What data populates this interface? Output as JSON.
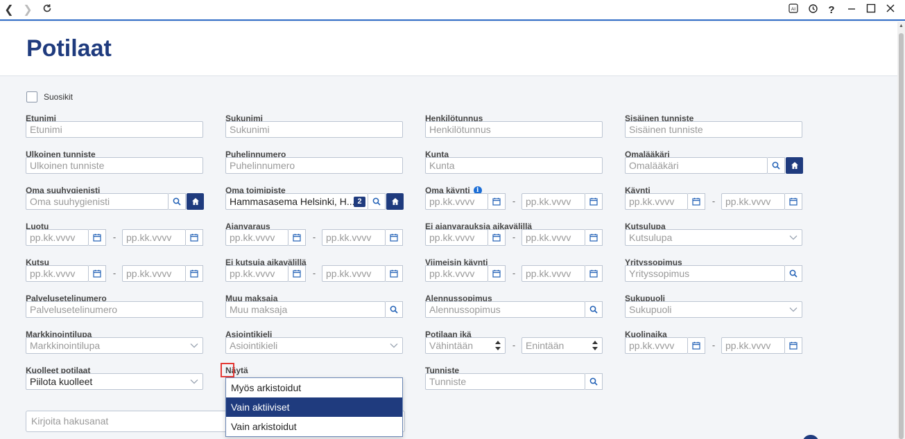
{
  "topbar": {
    "back_icon": "back-arrow-icon",
    "forward_icon": "forward-arrow-icon",
    "reload_icon": "reload-icon",
    "ai_label": "AI",
    "help_label": "?"
  },
  "page": {
    "title": "Potilaat"
  },
  "favorites": {
    "label": "Suosikit",
    "checked": false
  },
  "fields": {
    "etunimi": {
      "label": "Etunimi",
      "placeholder": "Etunimi"
    },
    "sukunimi": {
      "label": "Sukunimi",
      "placeholder": "Sukunimi"
    },
    "henkilotunnus": {
      "label": "Henkilötunnus",
      "placeholder": "Henkilötunnus"
    },
    "sisainen": {
      "label": "Sisäinen tunniste",
      "placeholder": "Sisäinen tunniste"
    },
    "ulkoinen": {
      "label": "Ulkoinen tunniste",
      "placeholder": "Ulkoinen tunniste"
    },
    "puhelin": {
      "label": "Puhelinnumero",
      "placeholder": "Puhelinnumero"
    },
    "kunta": {
      "label": "Kunta",
      "placeholder": "Kunta"
    },
    "omalaakari": {
      "label": "Omalääkäri",
      "placeholder": "Omalääkäri"
    },
    "suuhygienisti": {
      "label": "Oma suuhygienisti",
      "placeholder": "Oma suuhygienisti"
    },
    "toimipiste": {
      "label": "Oma toimipiste",
      "value": "Hammasasema Helsinki, H...",
      "badge": "2"
    },
    "omakaynti": {
      "label": "Oma käynti",
      "info": "i",
      "from": "pp.kk.vvvv",
      "to": "pp.kk.vvvv"
    },
    "kaynti": {
      "label": "Käynti",
      "from": "pp.kk.vvvv",
      "to": "pp.kk.vvvv"
    },
    "luotu": {
      "label": "Luotu",
      "from": "pp.kk.vvvv",
      "to": "pp.kk.vvvv"
    },
    "ajanvaraus": {
      "label": "Ajanvaraus",
      "from": "pp.kk.vvvv",
      "to": "pp.kk.vvvv"
    },
    "eiajanvarauksia": {
      "label": "Ei ajanvarauksia aikavälillä",
      "from": "pp.kk.vvvv",
      "to": "pp.kk.vvvv"
    },
    "kutsulupa": {
      "label": "Kutsulupa",
      "placeholder": "Kutsulupa"
    },
    "kutsu": {
      "label": "Kutsu",
      "from": "pp.kk.vvvv",
      "to": "pp.kk.vvvv"
    },
    "eikutsuja": {
      "label": "Ei kutsuja aikavälillä",
      "from": "pp.kk.vvvv",
      "to": "pp.kk.vvvv"
    },
    "viimeisin": {
      "label": "Viimeisin käynti",
      "from": "pp.kk.vvvv",
      "to": "pp.kk.vvvv"
    },
    "yrityssopimus": {
      "label": "Yrityssopimus",
      "placeholder": "Yrityssopimus"
    },
    "palveluseteli": {
      "label": "Palvelusetelinumero",
      "placeholder": "Palvelusetelinumero"
    },
    "muumaksaja": {
      "label": "Muu maksaja",
      "placeholder": "Muu maksaja"
    },
    "alennus": {
      "label": "Alennussopimus",
      "placeholder": "Alennussopimus"
    },
    "sukupuoli": {
      "label": "Sukupuoli",
      "placeholder": "Sukupuoli"
    },
    "markkinointi": {
      "label": "Markkinointilupa",
      "placeholder": "Markkinointilupa"
    },
    "asiointikieli": {
      "label": "Asiointikieli",
      "placeholder": "Asiointikieli"
    },
    "potilaanika": {
      "label": "Potilaan ikä",
      "min": "Vähintään",
      "max": "Enintään"
    },
    "kuolinaika": {
      "label": "Kuolinaika",
      "from": "pp.kk.vvvv",
      "to": "pp.kk.vvvv"
    },
    "kuolleet": {
      "label": "Kuolleet potilaat",
      "value": "Piilota kuolleet"
    },
    "nayta": {
      "label": "Näytä"
    },
    "tunniste": {
      "label": "Tunniste",
      "placeholder": "Tunniste"
    }
  },
  "dropdown": {
    "options": [
      "Myös arkistoidut",
      "Vain aktiiviset",
      "Vain arkistoidut"
    ],
    "selected": "Vain aktiiviset"
  },
  "search": {
    "placeholder": "Kirjoita hakusanat"
  },
  "colors": {
    "accent": "#1f3b7e",
    "link": "#1f5fb5",
    "highlight": "#e53935"
  }
}
